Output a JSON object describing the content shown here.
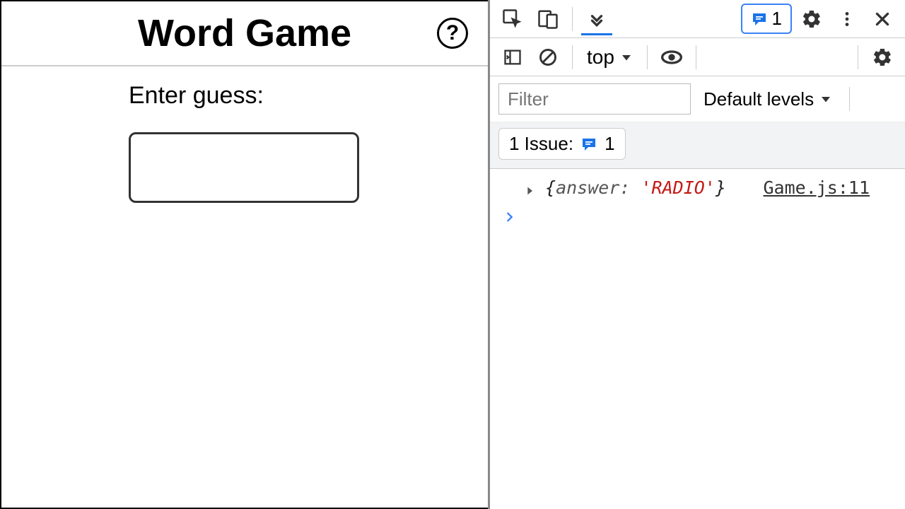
{
  "app": {
    "title": "Word Game",
    "help_icon_glyph": "?",
    "guess_label": "Enter guess:",
    "guess_value": ""
  },
  "devtools": {
    "tabbar": {
      "issue_count": "1"
    },
    "toolbar": {
      "context": "top"
    },
    "filter": {
      "placeholder": "Filter",
      "levels_label": "Default levels"
    },
    "issues": {
      "label": "1 Issue:",
      "count": "1"
    },
    "console": {
      "entries": [
        {
          "brace_open": "{",
          "key": "answer:",
          "value": "'RADIO'",
          "brace_close": "}",
          "source": "Game.js:11"
        }
      ],
      "prompt": "›"
    }
  }
}
